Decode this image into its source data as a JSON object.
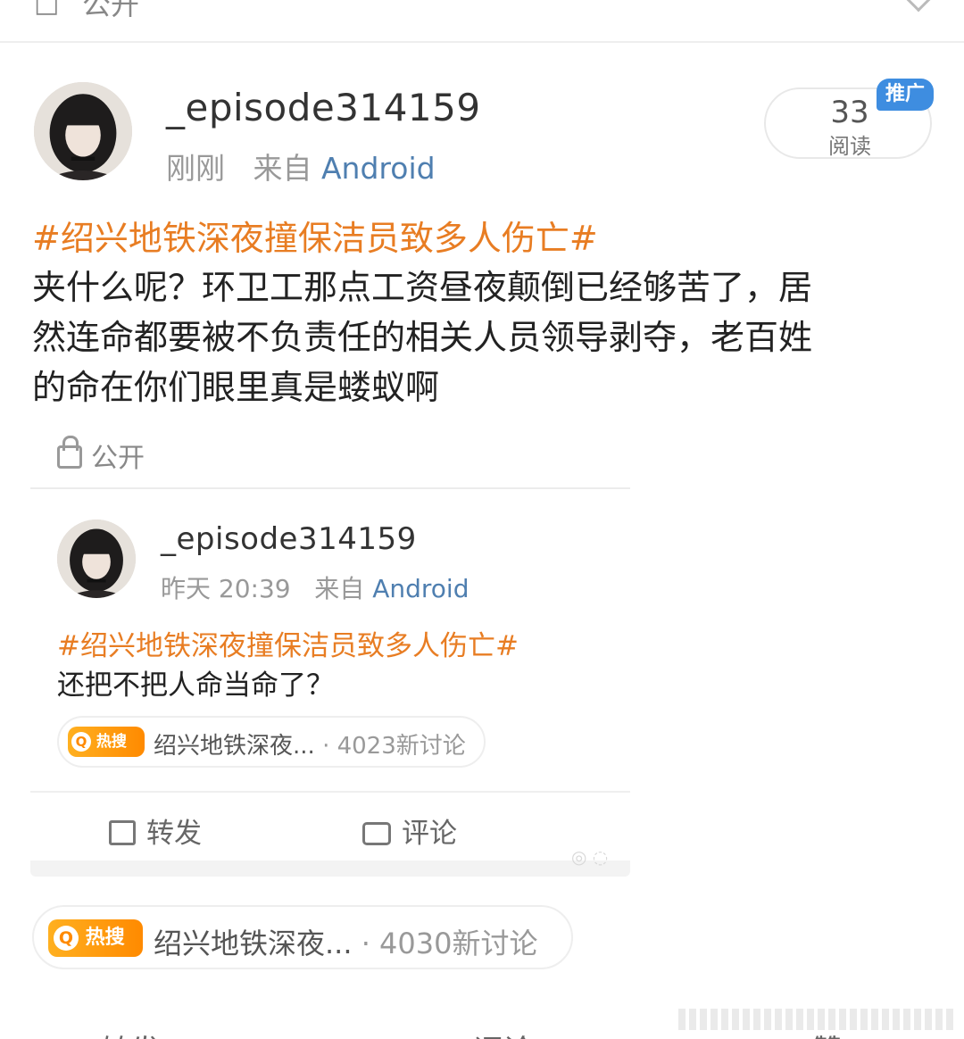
{
  "top_bar": {
    "visibility_label": "公开"
  },
  "post": {
    "username": "_episode314159",
    "time": "刚刚",
    "from_prefix": "来自",
    "source": "Android",
    "reads": {
      "count": "33",
      "label": "阅读"
    },
    "promo_label": "推广",
    "topic": "#绍兴地铁深夜撞保洁员致多人伤亡#",
    "body_lines": [
      "夹什么呢？环卫工那点工资昼夜颠倒已经够苦了，居",
      "然连命都要被不负责任的相关人员领导剥夺，老百姓",
      "的命在你们眼里真是蝼蚁啊"
    ],
    "visibility": "公开"
  },
  "quoted": {
    "username": "_episode314159",
    "time": "昨天 20:39",
    "from_prefix": "来自",
    "source": "Android",
    "topic": "#绍兴地铁深夜撞保洁员致多人伤亡#",
    "body": "还把不把人命当命了？",
    "hot": {
      "tag": "热搜",
      "title": "绍兴地铁深夜...",
      "count": "· 4023新讨论"
    },
    "actions": {
      "repost": "转发",
      "comment": "评论"
    }
  },
  "hot_main": {
    "tag": "热搜",
    "title": "绍兴地铁深夜...",
    "count": "· 4030新讨论"
  },
  "bottom_actions": {
    "repost": "转发",
    "comment": "评论",
    "like": "赞"
  },
  "colors": {
    "topic": "#e87d23",
    "source": "#4f7fb0",
    "promo": "#3e8de0",
    "hot": "#ff8a00"
  }
}
